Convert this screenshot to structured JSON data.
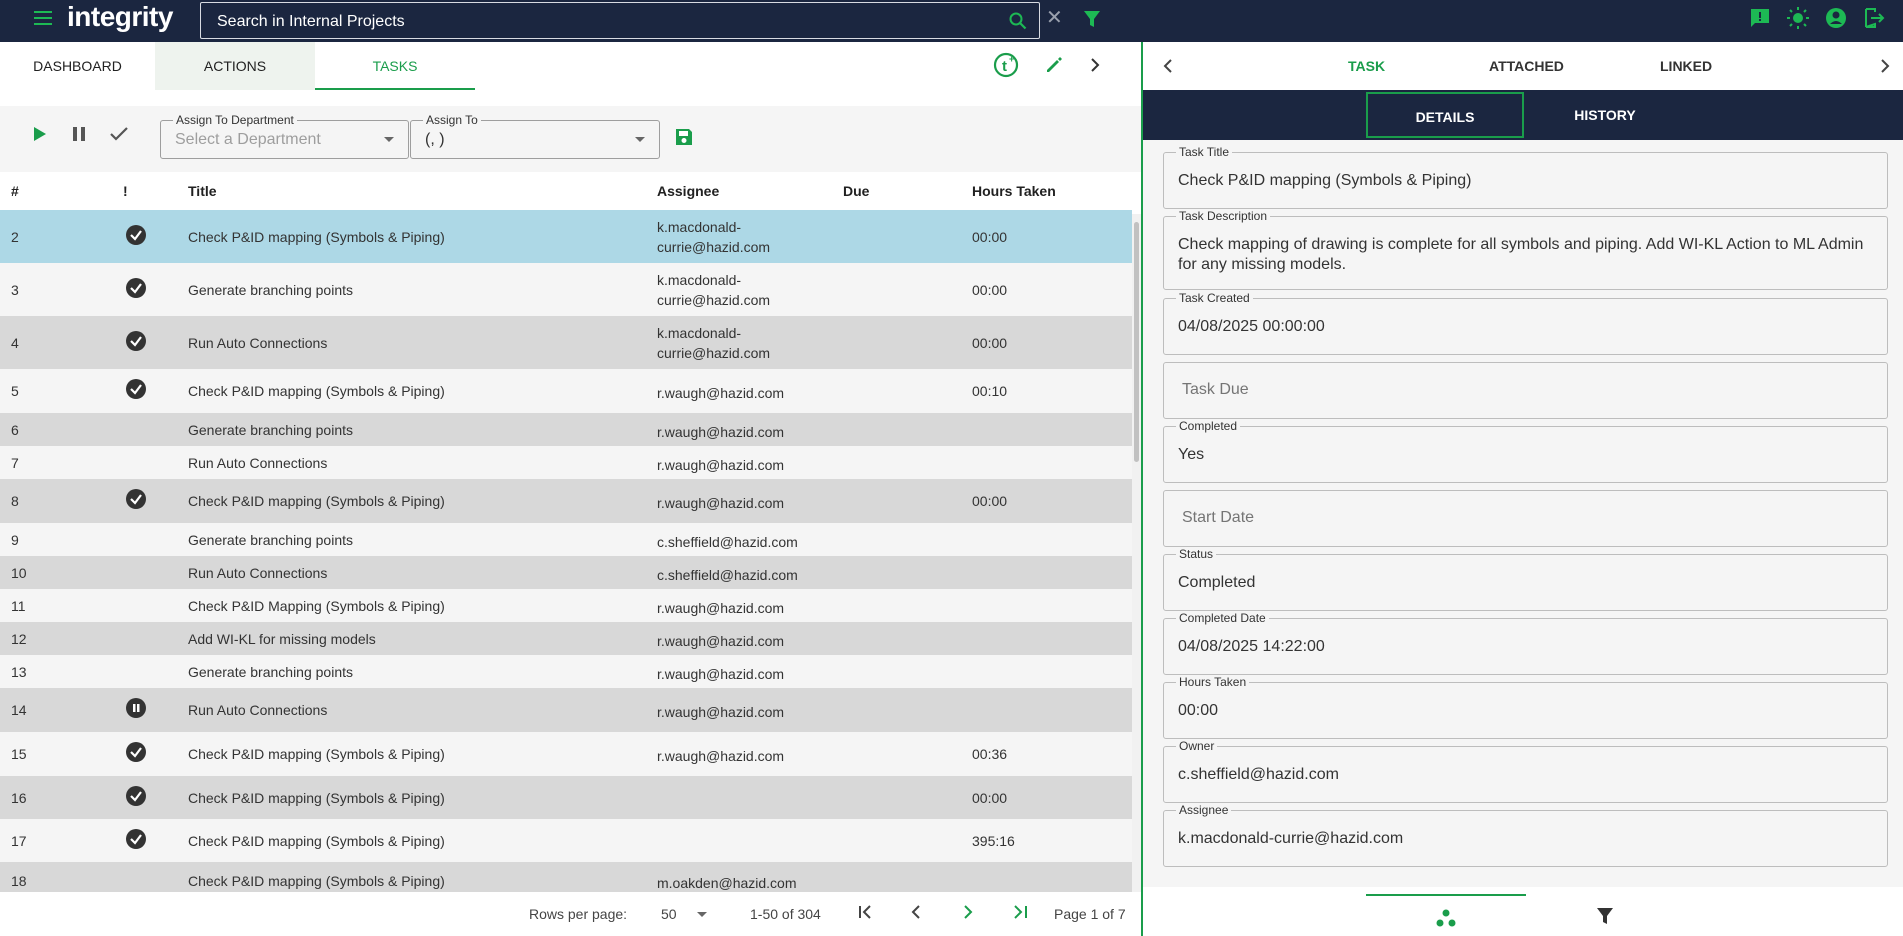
{
  "app": {
    "logo": "integrity",
    "search_placeholder": "Search in Internal Projects",
    "icons": [
      "menu-icon",
      "search-icon",
      "close-icon",
      "filter-icon",
      "feedback-icon",
      "theme-icon",
      "account-icon",
      "logout-icon"
    ],
    "accent_color": "#1a9d4b",
    "header_color": "#1b2640"
  },
  "left": {
    "tabs": [
      {
        "label": "DASHBOARD"
      },
      {
        "label": "ACTIONS"
      },
      {
        "label": "TASKS"
      }
    ],
    "toolbar": {
      "department_label": "Assign To Department",
      "department_placeholder": "Select a Department",
      "assign_label": "Assign To",
      "assign_value": "(, )"
    },
    "table": {
      "headers": {
        "num": "#",
        "flag": "!",
        "title": "Title",
        "assignee": "Assignee",
        "due": "Due",
        "hours": "Hours Taken"
      },
      "rows": [
        {
          "num": "2",
          "status": "done",
          "title": "Check P&ID mapping (Symbols & Piping)",
          "assignee": "k.macdonald-currie@hazid.com",
          "hours": "00:00",
          "selected": true
        },
        {
          "num": "3",
          "status": "done",
          "title": "Generate branching points",
          "assignee": "k.macdonald-currie@hazid.com",
          "hours": "00:00"
        },
        {
          "num": "4",
          "status": "done",
          "title": "Run Auto Connections",
          "assignee": "k.macdonald-currie@hazid.com",
          "hours": "00:00"
        },
        {
          "num": "5",
          "status": "done",
          "title": "Check P&ID mapping (Symbols & Piping)",
          "assignee": "r.waugh@hazid.com",
          "hours": "00:10"
        },
        {
          "num": "6",
          "status": "",
          "title": "Generate branching points",
          "assignee": "r.waugh@hazid.com",
          "hours": ""
        },
        {
          "num": "7",
          "status": "",
          "title": "Run Auto Connections",
          "assignee": "r.waugh@hazid.com",
          "hours": ""
        },
        {
          "num": "8",
          "status": "done",
          "title": "Check P&ID mapping (Symbols & Piping)",
          "assignee": "r.waugh@hazid.com",
          "hours": "00:00"
        },
        {
          "num": "9",
          "status": "",
          "title": "Generate branching points",
          "assignee": "c.sheffield@hazid.com",
          "hours": ""
        },
        {
          "num": "10",
          "status": "",
          "title": "Run Auto Connections",
          "assignee": "c.sheffield@hazid.com",
          "hours": ""
        },
        {
          "num": "11",
          "status": "",
          "title": "Check P&ID Mapping (Symbols & Piping)",
          "assignee": "r.waugh@hazid.com",
          "hours": ""
        },
        {
          "num": "12",
          "status": "",
          "title": "Add WI-KL for missing models",
          "assignee": "r.waugh@hazid.com",
          "hours": ""
        },
        {
          "num": "13",
          "status": "",
          "title": "Generate branching points",
          "assignee": "r.waugh@hazid.com",
          "hours": ""
        },
        {
          "num": "14",
          "status": "paused",
          "title": "Run Auto Connections",
          "assignee": "r.waugh@hazid.com",
          "hours": ""
        },
        {
          "num": "15",
          "status": "done",
          "title": "Check P&ID mapping (Symbols & Piping)",
          "assignee": "r.waugh@hazid.com",
          "hours": "00:36"
        },
        {
          "num": "16",
          "status": "done",
          "title": "Check P&ID mapping (Symbols & Piping)",
          "assignee": "",
          "hours": "00:00"
        },
        {
          "num": "17",
          "status": "done",
          "title": "Check P&ID mapping (Symbols & Piping)",
          "assignee": "",
          "hours": "395:16"
        },
        {
          "num": "18",
          "status": "",
          "title": "Check P&ID mapping (Symbols & Piping)",
          "assignee": "m.oakden@hazid.com",
          "hours": ""
        }
      ]
    },
    "pager": {
      "rows_label": "Rows per page:",
      "rows_value": "50",
      "range": "1-50 of 304",
      "page": "Page 1 of 7"
    }
  },
  "right": {
    "tabs": [
      {
        "label": "TASK"
      },
      {
        "label": "ATTACHED"
      },
      {
        "label": "LINKED"
      }
    ],
    "sub_tabs": [
      {
        "label": "DETAILS"
      },
      {
        "label": "HISTORY"
      }
    ],
    "fields": {
      "title_label": "Task Title",
      "title_value": "Check P&ID mapping (Symbols & Piping)",
      "desc_label": "Task Description",
      "desc_value": "Check mapping of drawing is complete for all symbols and piping. Add WI-KL Action to ML Admin for any missing models.",
      "created_label": "Task Created",
      "created_value": "04/08/2025 00:00:00",
      "due_placeholder": "Task Due",
      "completed_label": "Completed",
      "completed_value": "Yes",
      "start_placeholder": "Start Date",
      "status_label": "Status",
      "status_value": "Completed",
      "completed_date_label": "Completed Date",
      "completed_date_value": "04/08/2025 14:22:00",
      "hours_label": "Hours Taken",
      "hours_value": "00:00",
      "owner_label": "Owner",
      "owner_value": "c.sheffield@hazid.com",
      "assignee_label": "Assignee",
      "assignee_value": "k.macdonald-currie@hazid.com"
    }
  }
}
